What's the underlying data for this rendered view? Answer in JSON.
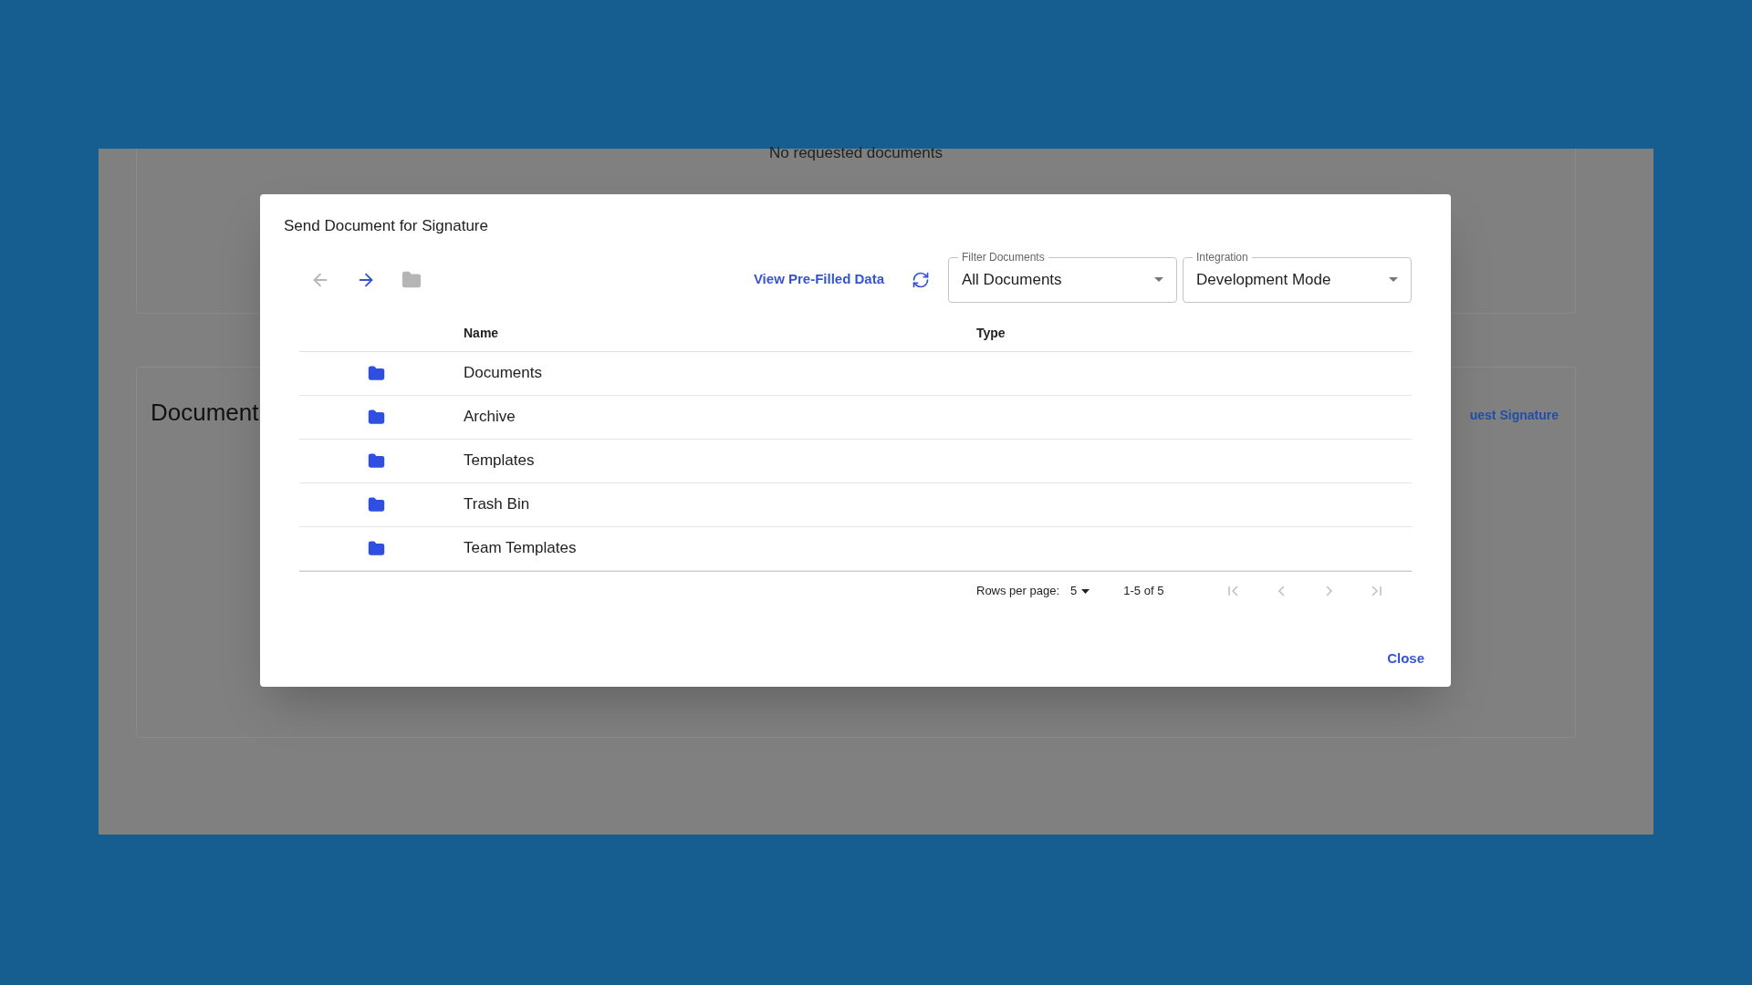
{
  "backdrop": {
    "empty_state": "No requested documents",
    "section_title": "Document",
    "action_link": "uest Signature"
  },
  "dialog": {
    "title": "Send Document for Signature",
    "nav": [
      {
        "kind": "back",
        "disabled": true
      },
      {
        "kind": "forward",
        "disabled": false
      },
      {
        "kind": "folder",
        "disabled": true
      }
    ],
    "link": "View Pre-Filled Data",
    "selects": [
      {
        "label": "Filter Documents",
        "value": "All Documents"
      },
      {
        "label": "Integration",
        "value": "Development Mode"
      }
    ],
    "table": {
      "columns": [
        "Name",
        "Type"
      ],
      "rows": [
        {
          "name": "Documents"
        },
        {
          "name": "Archive"
        },
        {
          "name": "Templates"
        },
        {
          "name": "Trash Bin"
        },
        {
          "name": "Team Templates"
        }
      ]
    },
    "pagination": {
      "rows_label": "Rows per page:",
      "rows_value": "5",
      "range": "1-5 of 5",
      "buttons": [
        {
          "kind": "first",
          "disabled": true
        },
        {
          "kind": "prev",
          "disabled": true
        },
        {
          "kind": "next",
          "disabled": true
        },
        {
          "kind": "last",
          "disabled": true
        }
      ]
    },
    "close": "Close"
  }
}
